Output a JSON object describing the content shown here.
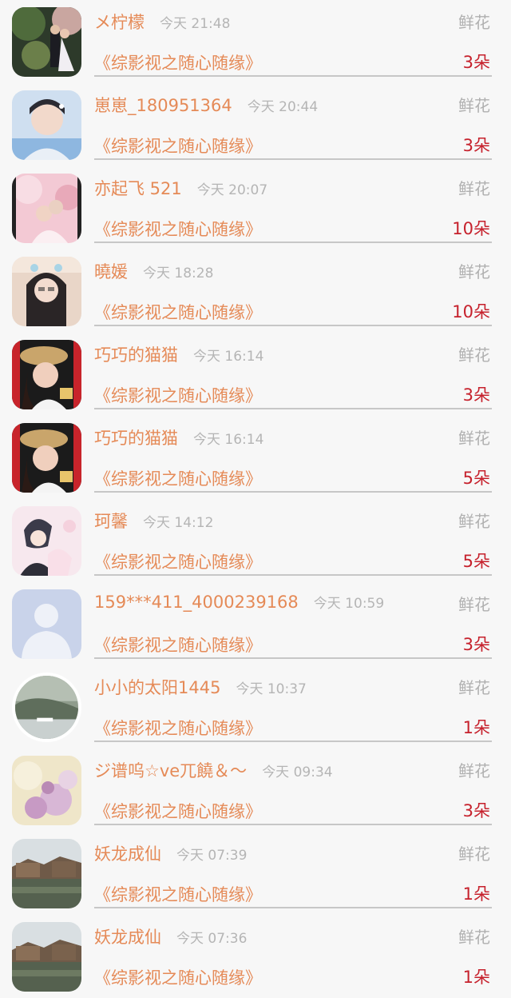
{
  "items": [
    {
      "name": "メ柠檬",
      "time": "今天 21:48",
      "gift": "鲜花",
      "book": "《综影视之随心随缘》",
      "count": "3朵",
      "avatar": "couple-photo"
    },
    {
      "name": "崽崽_180951364",
      "time": "今天 20:44",
      "gift": "鲜花",
      "book": "《综影视之随心随缘》",
      "count": "3朵",
      "avatar": "boy-photo"
    },
    {
      "name": "亦起飞 521",
      "time": "今天 20:07",
      "gift": "鲜花",
      "book": "《综影视之随心随缘》",
      "count": "10朵",
      "avatar": "pink-couple-photo"
    },
    {
      "name": "曉媛",
      "time": "今天 18:28",
      "gift": "鲜花",
      "book": "《综影视之随心随缘》",
      "count": "10朵",
      "avatar": "girl-selfie"
    },
    {
      "name": "巧巧的猫猫",
      "time": "今天 16:14",
      "gift": "鲜花",
      "book": "《综影视之随心随缘》",
      "count": "3朵",
      "avatar": "woman-hat-photo"
    },
    {
      "name": "巧巧的猫猫",
      "time": "今天 16:14",
      "gift": "鲜花",
      "book": "《综影视之随心随缘》",
      "count": "5朵",
      "avatar": "woman-hat-photo"
    },
    {
      "name": "珂馨",
      "time": "今天 14:12",
      "gift": "鲜花",
      "book": "《综影视之随心随缘》",
      "count": "5朵",
      "avatar": "anime-couple"
    },
    {
      "name": "159***411_4000239168",
      "time": "今天 10:59",
      "gift": "鲜花",
      "book": "《综影视之随心随缘》",
      "count": "3朵",
      "avatar": "default-user-avatar"
    },
    {
      "name": "小小的太阳1445",
      "time": "今天 10:37",
      "gift": "鲜花",
      "book": "《综影视之随心随缘》",
      "count": "1朵",
      "avatar": "landscape-round"
    },
    {
      "name": "ジ谱呜☆ve兀饒＆～",
      "time": "今天 09:34",
      "gift": "鲜花",
      "book": "《综影视之随心随缘》",
      "count": "3朵",
      "avatar": "flowers-photo"
    },
    {
      "name": "妖龙成仙",
      "time": "今天 07:39",
      "gift": "鲜花",
      "book": "《综影视之随心随缘》",
      "count": "1朵",
      "avatar": "river-town-photo"
    },
    {
      "name": "妖龙成仙",
      "time": "今天 07:36",
      "gift": "鲜花",
      "book": "《综影视之随心随缘》",
      "count": "1朵",
      "avatar": "river-town-photo"
    }
  ]
}
